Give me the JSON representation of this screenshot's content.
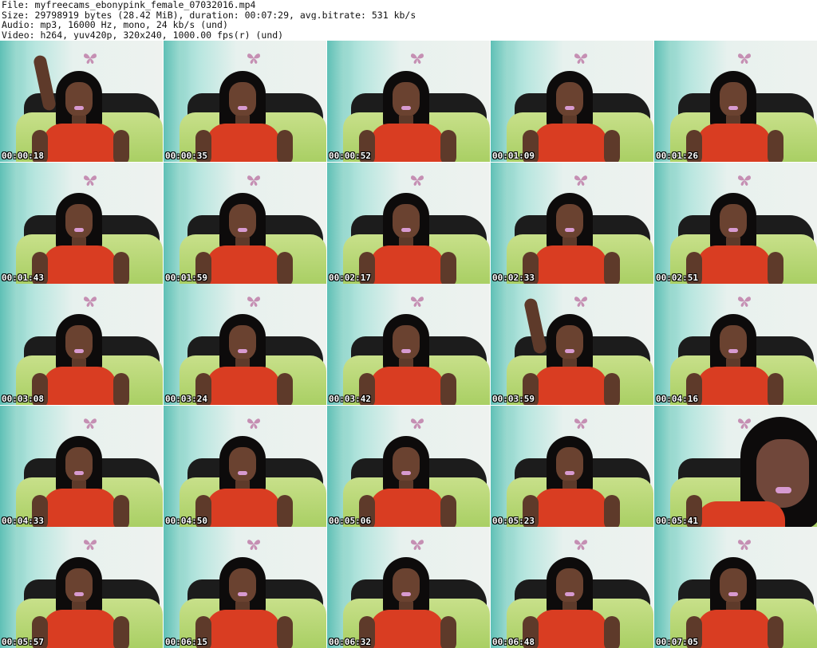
{
  "header": {
    "file_line": "File: myfreecams_ebonypink_female_07032016.mp4",
    "size_line": "Size: 29798919 bytes (28.42 MiB), duration: 00:07:29, avg.bitrate: 531 kb/s",
    "audio_line": "Audio: mp3, 16000 Hz, mono, 24 kb/s (und)",
    "video_line": "Video: h264, yuv420p, 320x240, 1000.00 fps(r) (und)"
  },
  "thumbnails": [
    {
      "timestamp": "00:00:18",
      "variant": "armup"
    },
    {
      "timestamp": "00:00:35",
      "variant": "normal"
    },
    {
      "timestamp": "00:00:52",
      "variant": "normal"
    },
    {
      "timestamp": "00:01:09",
      "variant": "normal"
    },
    {
      "timestamp": "00:01:26",
      "variant": "normal"
    },
    {
      "timestamp": "00:01:43",
      "variant": "normal"
    },
    {
      "timestamp": "00:01:59",
      "variant": "normal"
    },
    {
      "timestamp": "00:02:17",
      "variant": "normal"
    },
    {
      "timestamp": "00:02:33",
      "variant": "normal"
    },
    {
      "timestamp": "00:02:51",
      "variant": "normal"
    },
    {
      "timestamp": "00:03:08",
      "variant": "normal"
    },
    {
      "timestamp": "00:03:24",
      "variant": "normal"
    },
    {
      "timestamp": "00:03:42",
      "variant": "normal"
    },
    {
      "timestamp": "00:03:59",
      "variant": "armup"
    },
    {
      "timestamp": "00:04:16",
      "variant": "normal"
    },
    {
      "timestamp": "00:04:33",
      "variant": "normal"
    },
    {
      "timestamp": "00:04:50",
      "variant": "normal"
    },
    {
      "timestamp": "00:05:06",
      "variant": "normal"
    },
    {
      "timestamp": "00:05:23",
      "variant": "normal"
    },
    {
      "timestamp": "00:05:41",
      "variant": "closeup"
    },
    {
      "timestamp": "00:05:57",
      "variant": "normal"
    },
    {
      "timestamp": "00:06:15",
      "variant": "normal"
    },
    {
      "timestamp": "00:06:32",
      "variant": "normal"
    },
    {
      "timestamp": "00:06:48",
      "variant": "normal"
    },
    {
      "timestamp": "00:07:05",
      "variant": "normal"
    }
  ],
  "grid": {
    "columns": 5,
    "rows": 5
  },
  "icons": {
    "butterfly": "butterfly-icon"
  },
  "colors": {
    "timestamp_text": "#ffffff",
    "timestamp_outline": "#000000",
    "background": "#ffffff"
  }
}
